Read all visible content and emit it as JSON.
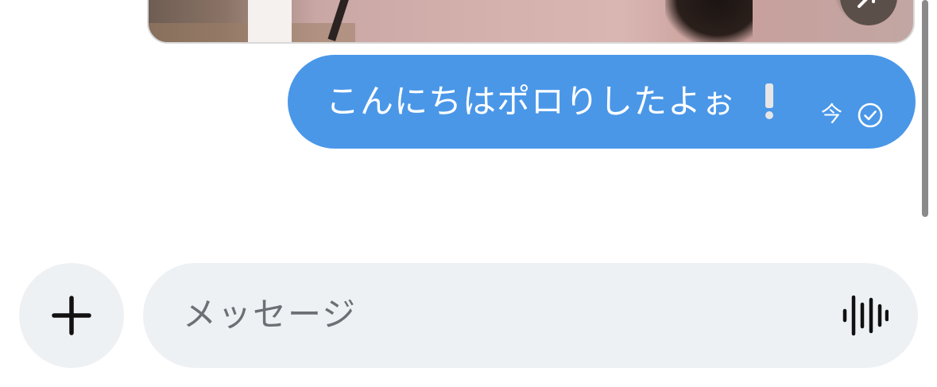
{
  "media_message": {
    "action_icon": "share-arrow-icon"
  },
  "message": {
    "text": "こんにちはポロりしたよぉ",
    "emphasis": "!",
    "time": "今",
    "status_icon": "check-circle-icon",
    "bubble_color": "#4a97e8"
  },
  "composer": {
    "add_icon": "plus-icon",
    "placeholder": "メッセージ",
    "voice_icon": "voice-waveform-icon"
  }
}
